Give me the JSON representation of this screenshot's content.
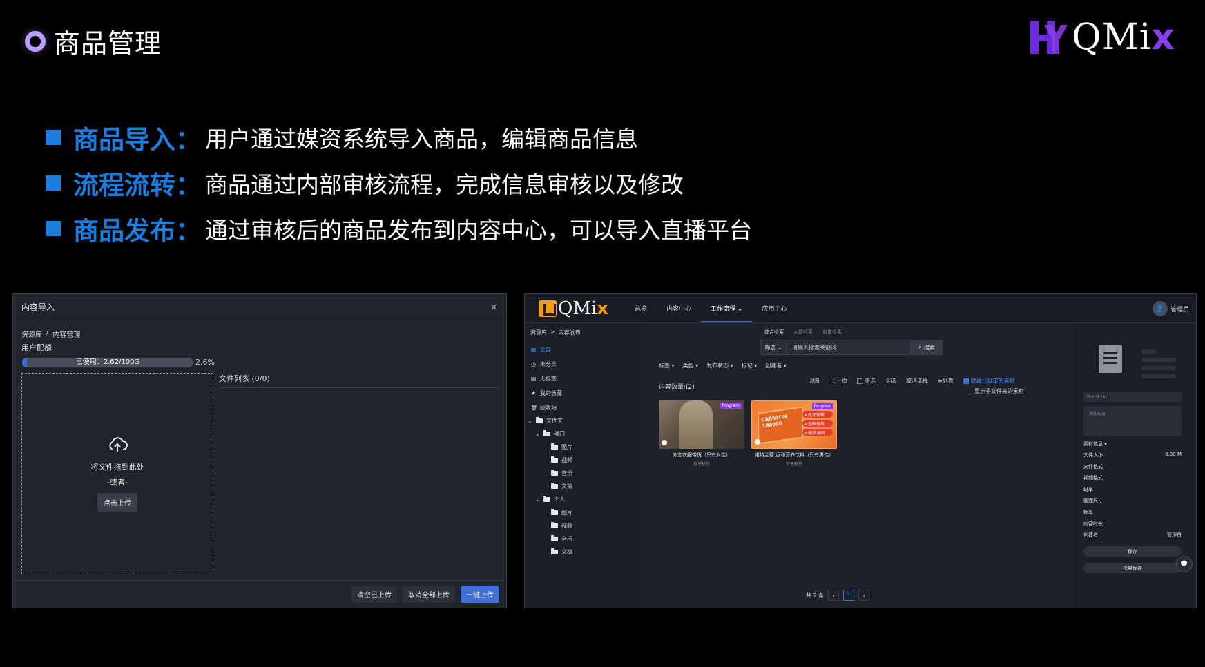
{
  "slide": {
    "title": "商品管理",
    "brand": {
      "word": "QMi",
      "x": "x"
    }
  },
  "bullets": [
    {
      "key": "商品导入",
      "colon": "：",
      "desc": "用户通过媒资系统导入商品，编辑商品信息"
    },
    {
      "key": "流程流转",
      "colon": "：",
      "desc": "商品通过内部审核流程，完成信息审核以及修改"
    },
    {
      "key": "商品发布",
      "colon": "：",
      "desc": "通过审核后的商品发布到内容中心，可以导入直播平台"
    }
  ],
  "import_dialog": {
    "title": "内容导入",
    "close": "×",
    "breadcrumb": [
      "资源库",
      "/",
      "内容管理"
    ],
    "quota_label": "用户配额",
    "usage_text": "已使用：2.62/100G",
    "usage_percent": "2.6%",
    "usage_fraction": 0.026,
    "drop_text": "将文件拖到此处",
    "drop_or": "-或者-",
    "upload_button": "点击上传",
    "file_list_title": "文件列表 (0/0)",
    "footer_buttons": {
      "clear": "清空已上传",
      "cancel_all": "取消全部上传",
      "upload_all": "一键上传"
    }
  },
  "app": {
    "logo": {
      "word": "QMi",
      "x": "x"
    },
    "nav": [
      "总览",
      "内容中心",
      "工作流程 ⌄",
      "应用中心"
    ],
    "user": "管理员",
    "breadcrumb": [
      "资源库",
      ">",
      "内容发布"
    ],
    "side_items": [
      {
        "icon": "▦",
        "label": "全部"
      },
      {
        "icon": "◷",
        "label": "未分类"
      },
      {
        "icon": "▤",
        "label": "无标签"
      },
      {
        "icon": "★",
        "label": "我的收藏"
      },
      {
        "icon": "🗑",
        "label": "回收站"
      }
    ],
    "tree": [
      {
        "caret": "⌄",
        "label": "文件夹",
        "level": 0
      },
      {
        "caret": "⌄",
        "label": "部门",
        "level": 1
      },
      {
        "caret": "",
        "label": "图片",
        "level": 2
      },
      {
        "caret": "",
        "label": "视频",
        "level": 2
      },
      {
        "caret": "",
        "label": "音乐",
        "level": 2
      },
      {
        "caret": "",
        "label": "文稿",
        "level": 2
      },
      {
        "caret": "⌄",
        "label": "个人",
        "level": 1
      },
      {
        "caret": "",
        "label": "图片",
        "level": 2
      },
      {
        "caret": "",
        "label": "视频",
        "level": 2
      },
      {
        "caret": "",
        "label": "音乐",
        "level": 2
      },
      {
        "caret": "",
        "label": "文稿",
        "level": 2
      }
    ],
    "search_tabs": [
      "综合检索",
      "人脸检索",
      "对象检索"
    ],
    "filter_label": "筛选 ⌄",
    "search_placeholder": "请输入搜索关键词",
    "search_button": "搜索",
    "filters": [
      "标签 ▾",
      "类型 ▾",
      "发布状态 ▾",
      "标记 ▾",
      "创建者 ▾"
    ],
    "count_label": "内容数量:(2)",
    "actions": {
      "refresh": "刷新",
      "prev": "上一页",
      "multi": "多选",
      "select_all": "全选",
      "cancel_select": "取消选择",
      "list": "≡列表",
      "hide_bound": "隐藏已绑定的素材",
      "show_sub": "显示子文件夹的素材"
    },
    "cards": [
      {
        "title": "外套衣服带货（只有女性）",
        "sub": "暂无标签",
        "tag": "Program"
      },
      {
        "title": "诺特兰德 运动营养饮料（只有男性）",
        "sub": "暂无标签",
        "tag": "Program",
        "features": [
          "✔热汗狂飙",
          "✔基础有氧",
          "✔高纬发图"
        ],
        "brand_text": "CARNITIN 100000"
      }
    ],
    "pager": {
      "total": "共 2 条",
      "prev": "‹",
      "current": "1",
      "next": "›"
    },
    "right_panel": {
      "filename": "Text8.txt",
      "tag_placeholder": "添加标签",
      "meta_head": "素材信息 ▾",
      "meta": [
        {
          "k": "文件大小",
          "v": "0.00 M"
        },
        {
          "k": "文件格式",
          "v": ""
        },
        {
          "k": "视频格式",
          "v": ""
        },
        {
          "k": "码率",
          "v": ""
        },
        {
          "k": "画面尺寸",
          "v": ""
        },
        {
          "k": "帧率",
          "v": ""
        },
        {
          "k": "内容时长",
          "v": ""
        },
        {
          "k": "创建者",
          "v": "管理员"
        }
      ],
      "save": "保存",
      "batch_save": "批量保存"
    }
  },
  "colors": {
    "accent_blue": "#1a7ee0",
    "brand_purple": "#8a3df0",
    "primary_button": "#3f6ed8",
    "logo_orange": "#f29b16"
  }
}
